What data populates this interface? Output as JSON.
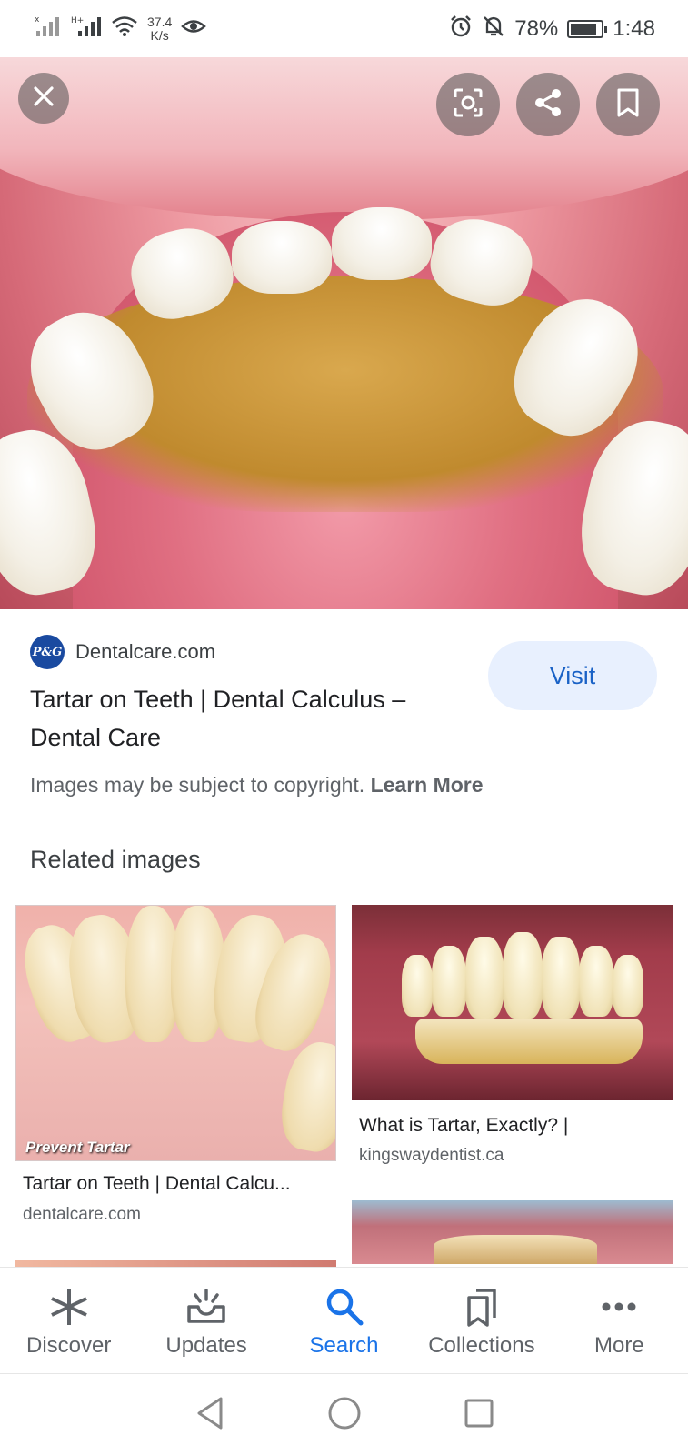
{
  "status_bar": {
    "net_speed_value": "37.4",
    "net_speed_unit": "K/s",
    "battery": "78%",
    "time": "1:48",
    "icons": [
      "signal-icon",
      "signal-h-icon",
      "wifi-icon",
      "eye-icon",
      "alarm-icon",
      "mute-icon",
      "battery-icon"
    ]
  },
  "viewer": {
    "actions": [
      "close-icon",
      "lens-icon",
      "share-icon",
      "bookmark-icon"
    ]
  },
  "source": {
    "logo_text": "P&G",
    "site": "Dentalcare.com",
    "title": "Tartar on Teeth | Dental Calculus – Dental Care",
    "visit_label": "Visit",
    "copyright_text": "Images may be subject to copyright.",
    "learn_more": "Learn More"
  },
  "related": {
    "heading": "Related images",
    "items": [
      {
        "overlay": "Prevent Tartar",
        "title": "Tartar on Teeth | Dental Calcu...",
        "site": "dentalcare.com"
      },
      {
        "title": "What is Tartar, Exactly? |",
        "site": "kingswaydentist.ca"
      }
    ]
  },
  "bottom_nav": {
    "items": [
      {
        "label": "Discover",
        "icon": "asterisk-icon",
        "active": false
      },
      {
        "label": "Updates",
        "icon": "updates-tray-icon",
        "active": false
      },
      {
        "label": "Search",
        "icon": "search-icon",
        "active": true
      },
      {
        "label": "Collections",
        "icon": "collections-icon",
        "active": false
      },
      {
        "label": "More",
        "icon": "more-dots-icon",
        "active": false
      }
    ]
  },
  "colors": {
    "accent": "#1a73e8",
    "visit_bg": "#e8f0fe",
    "logo_bg": "#1a4aa0"
  }
}
